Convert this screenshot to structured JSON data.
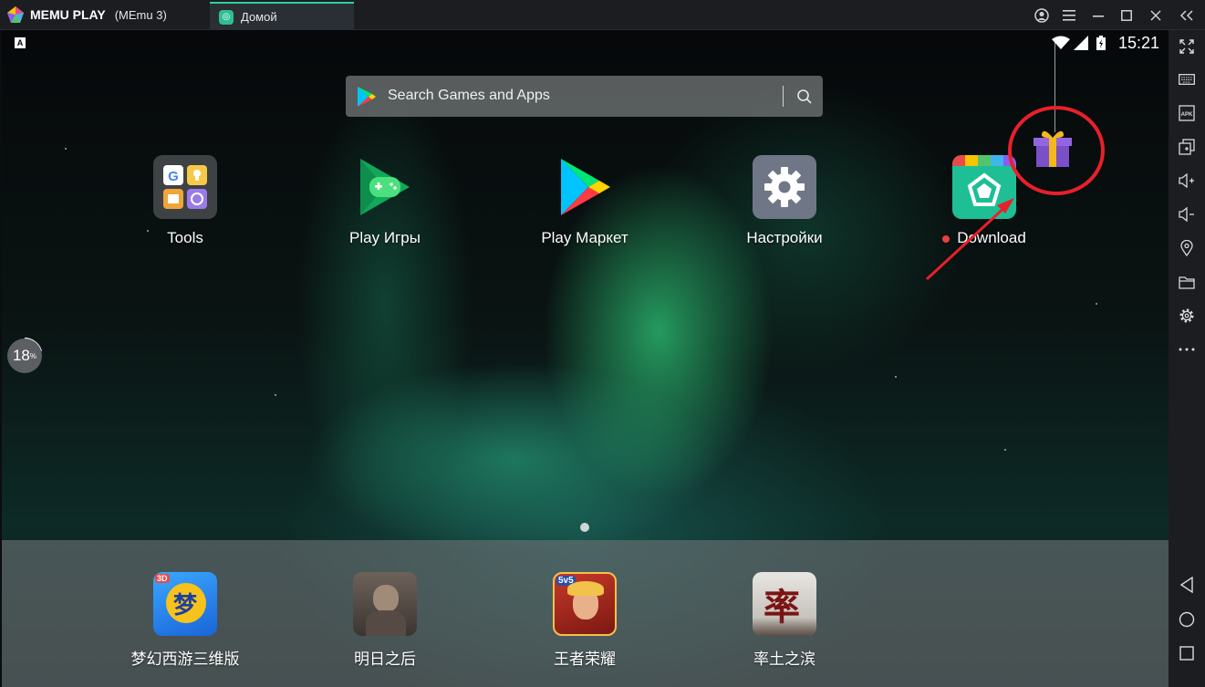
{
  "titlebar": {
    "brand": "MEMU PLAY",
    "instance": "(MEmu 3)",
    "tab_label": "Домой"
  },
  "status_bar": {
    "time": "15:21",
    "indicator": "A"
  },
  "search": {
    "placeholder": "Search Games and Apps"
  },
  "apps": [
    {
      "label": "Tools"
    },
    {
      "label": "Play Игры"
    },
    {
      "label": "Play Маркет"
    },
    {
      "label": "Настройки"
    },
    {
      "label": "Download"
    }
  ],
  "dock_apps": [
    {
      "label": "梦幻西游三维版"
    },
    {
      "label": "明日之后"
    },
    {
      "label": "王者荣耀"
    },
    {
      "label": "率土之滨"
    }
  ],
  "progress": {
    "value": "18",
    "unit": "%"
  },
  "sidebar": {
    "items": [
      "fullscreen-icon",
      "keyboard-icon",
      "apk-icon",
      "multi-window-icon",
      "volume-up-icon",
      "volume-down-icon",
      "location-icon",
      "folder-icon",
      "settings-icon",
      "more-icon"
    ],
    "nav": [
      "back-icon",
      "home-icon",
      "recents-icon"
    ]
  },
  "colors": {
    "accent": "#2fd0a0",
    "annotation": "#e8202a"
  }
}
